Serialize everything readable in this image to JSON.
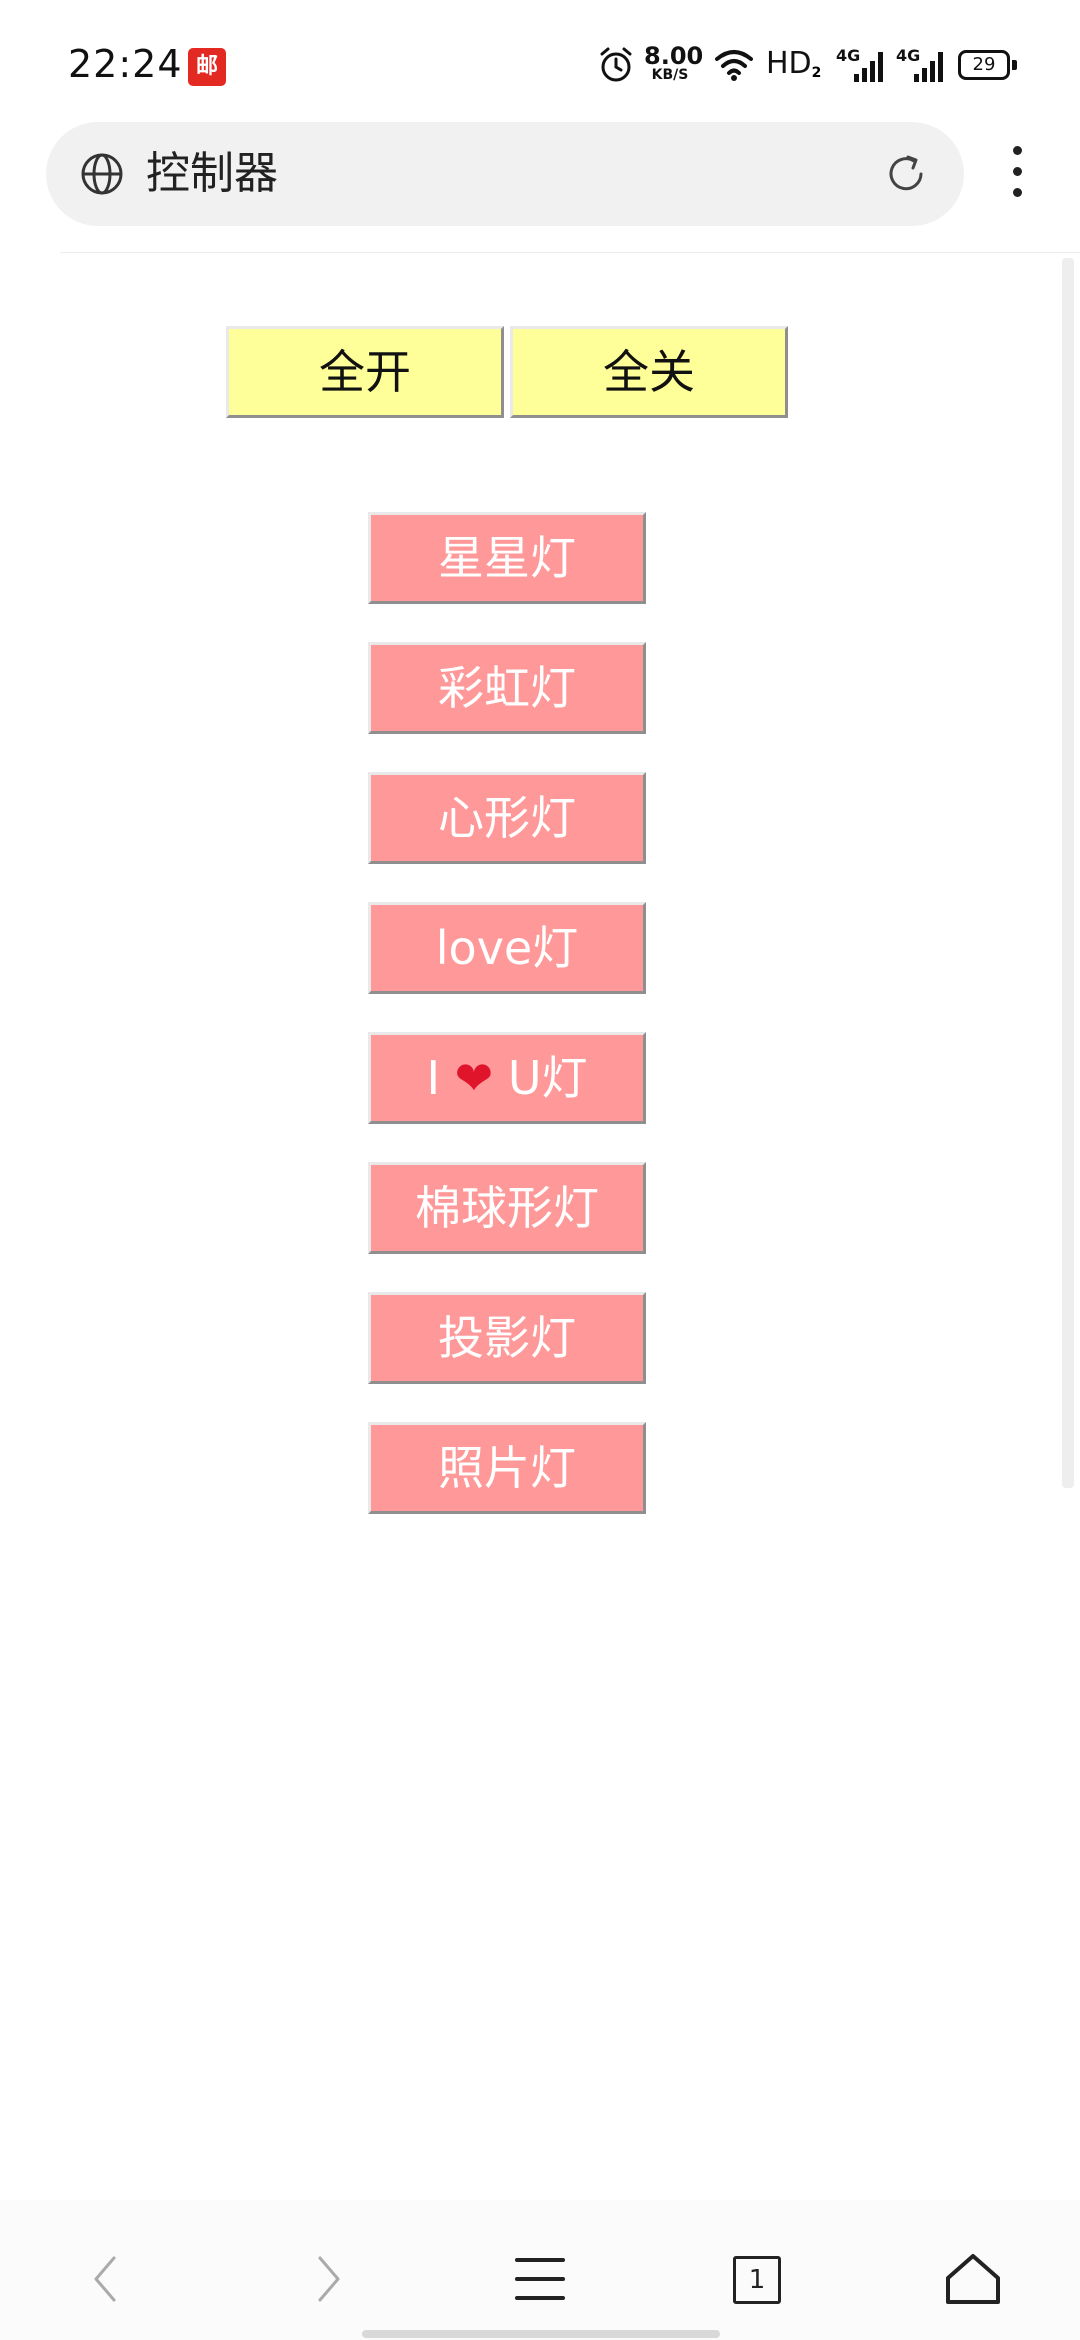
{
  "status_bar": {
    "time": "22:24",
    "app_badge": "邮",
    "net_speed_value": "8.00",
    "net_speed_unit": "KB/S",
    "hd_label": "HD",
    "hd_sub": "2",
    "sim1_network": "4G",
    "sim2_network": "4G",
    "battery_level": "29"
  },
  "browser": {
    "page_title": "控制器",
    "tab_count": "1"
  },
  "controls": {
    "all_on_label": "全开",
    "all_off_label": "全关"
  },
  "modes": {
    "star": "星星灯",
    "rainbow": "彩虹灯",
    "heart": "心形灯",
    "love": "love灯",
    "i_love_u_left": "I",
    "i_love_u_heart": "❤",
    "i_love_u_right": "U灯",
    "cotton_ball": "棉球形灯",
    "projection": "投影灯",
    "photo": "照片灯"
  },
  "colors": {
    "yellow_button": "#ffff99",
    "pink_button": "#ff9999",
    "heart": "#e0142a"
  }
}
